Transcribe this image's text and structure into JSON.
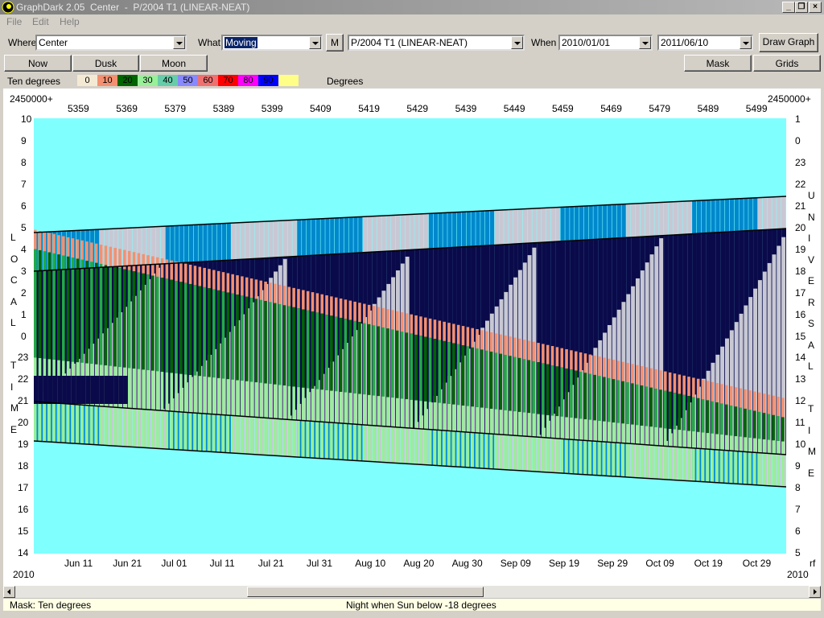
{
  "window": {
    "title": "GraphDark 2.05  Center  -  P/2004 T1 (LINEAR-NEAT)"
  },
  "menu": [
    "File",
    "Edit",
    "Help"
  ],
  "toolbar": {
    "where_label": "Where",
    "where_value": "Center",
    "what_label": "What",
    "what_value": "Moving",
    "m_button": "M",
    "object_value": "P/2004 T1 (LINEAR-NEAT)",
    "when_label": "When",
    "start_date": "2010/01/01",
    "end_date": "2011/06/10",
    "draw_button": "Draw Graph"
  },
  "buttons": {
    "now": "Now",
    "dusk": "Dusk",
    "moon": "Moon",
    "mask": "Mask",
    "grids": "Grids"
  },
  "legend": {
    "title": "Ten degrees",
    "units": "Degrees",
    "bins": [
      {
        "label": "0",
        "color": "#f4ead4"
      },
      {
        "label": "10",
        "color": "#f49070"
      },
      {
        "label": "20",
        "color": "#006400"
      },
      {
        "label": "30",
        "color": "#98f098"
      },
      {
        "label": "40",
        "color": "#66cdaa"
      },
      {
        "label": "50",
        "color": "#8888ff"
      },
      {
        "label": "60",
        "color": "#f07070"
      },
      {
        "label": "70",
        "color": "#ff0000"
      },
      {
        "label": "80",
        "color": "#ff00ff"
      },
      {
        "label": "90",
        "color": "#0000ff"
      },
      {
        "label": "",
        "color": "#ffff88"
      }
    ]
  },
  "graph": {
    "jd_prefix": "2450000+",
    "jd_ticks": [
      "5359",
      "5369",
      "5379",
      "5389",
      "5399",
      "5409",
      "5419",
      "5429",
      "5439",
      "5449",
      "5459",
      "5469",
      "5479",
      "5489",
      "5499"
    ],
    "left_axis_title": [
      "L",
      "O",
      "C",
      "A",
      "L",
      "",
      "T",
      "I",
      "M",
      "E"
    ],
    "right_axis_title": [
      "U",
      "N",
      "I",
      "V",
      "E",
      "R",
      "S",
      "A",
      "L",
      "",
      "T",
      "I",
      "M",
      "E"
    ],
    "left_ticks": [
      "10",
      "9",
      "8",
      "7",
      "6",
      "5",
      "4",
      "3",
      "2",
      "1",
      "0",
      "23",
      "22",
      "21",
      "20",
      "19",
      "18",
      "17",
      "16",
      "15",
      "14"
    ],
    "right_ticks": [
      "1",
      "0",
      "23",
      "22",
      "21",
      "20",
      "19",
      "18",
      "17",
      "16",
      "15",
      "14",
      "13",
      "12",
      "11",
      "10",
      "9",
      "8",
      "7",
      "6",
      "5"
    ],
    "date_ticks": [
      "Jun 11",
      "Jun 21",
      "Jul 01",
      "Jul 11",
      "Jul 21",
      "Jul 31",
      "Aug 10",
      "Aug 20",
      "Aug 30",
      "Sep 09",
      "Sep 19",
      "Sep 29",
      "Oct 09",
      "Oct 19",
      "Oct 29"
    ],
    "year_left": "2010",
    "year_right": "2010",
    "right_corner": "rf",
    "colors": {
      "day": "#80ffff",
      "twilight_blue": "#0088cc",
      "grey": "#c8c8d4",
      "night": "#0a0a4a",
      "salmon": "#f49070",
      "dgreen": "#006400",
      "mgreen": "#22aa44",
      "lgreen": "#98f098"
    }
  },
  "status": {
    "mask": "Mask:  Ten degrees",
    "night": "Night when Sun below -18 degrees"
  }
}
